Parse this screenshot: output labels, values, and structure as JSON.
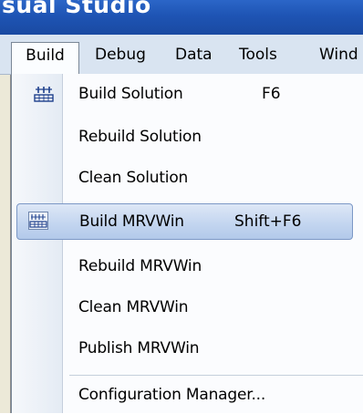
{
  "window": {
    "title_fragment": "sual Studio"
  },
  "menubar": {
    "items": [
      "Build",
      "Debug",
      "Data",
      "Tools",
      "Wind"
    ]
  },
  "build_menu": {
    "items": [
      {
        "label": "Build Solution",
        "shortcut": "F6",
        "icon": "build-icon"
      },
      {
        "label": "Rebuild Solution",
        "shortcut": ""
      },
      {
        "label": "Clean Solution",
        "shortcut": ""
      },
      {
        "label": "Build MRVWin",
        "shortcut": "Shift+F6",
        "icon": "build-project-icon",
        "highlighted": true
      },
      {
        "label": "Rebuild MRVWin",
        "shortcut": ""
      },
      {
        "label": "Clean MRVWin",
        "shortcut": ""
      },
      {
        "label": "Publish MRVWin",
        "shortcut": ""
      },
      {
        "label": "Configuration Manager...",
        "shortcut": ""
      }
    ]
  },
  "colors": {
    "titlebar": "#1e54b4",
    "menubar": "#d9e4f1",
    "highlight": "#c4d6f0",
    "highlight_border": "#7c98c6"
  }
}
